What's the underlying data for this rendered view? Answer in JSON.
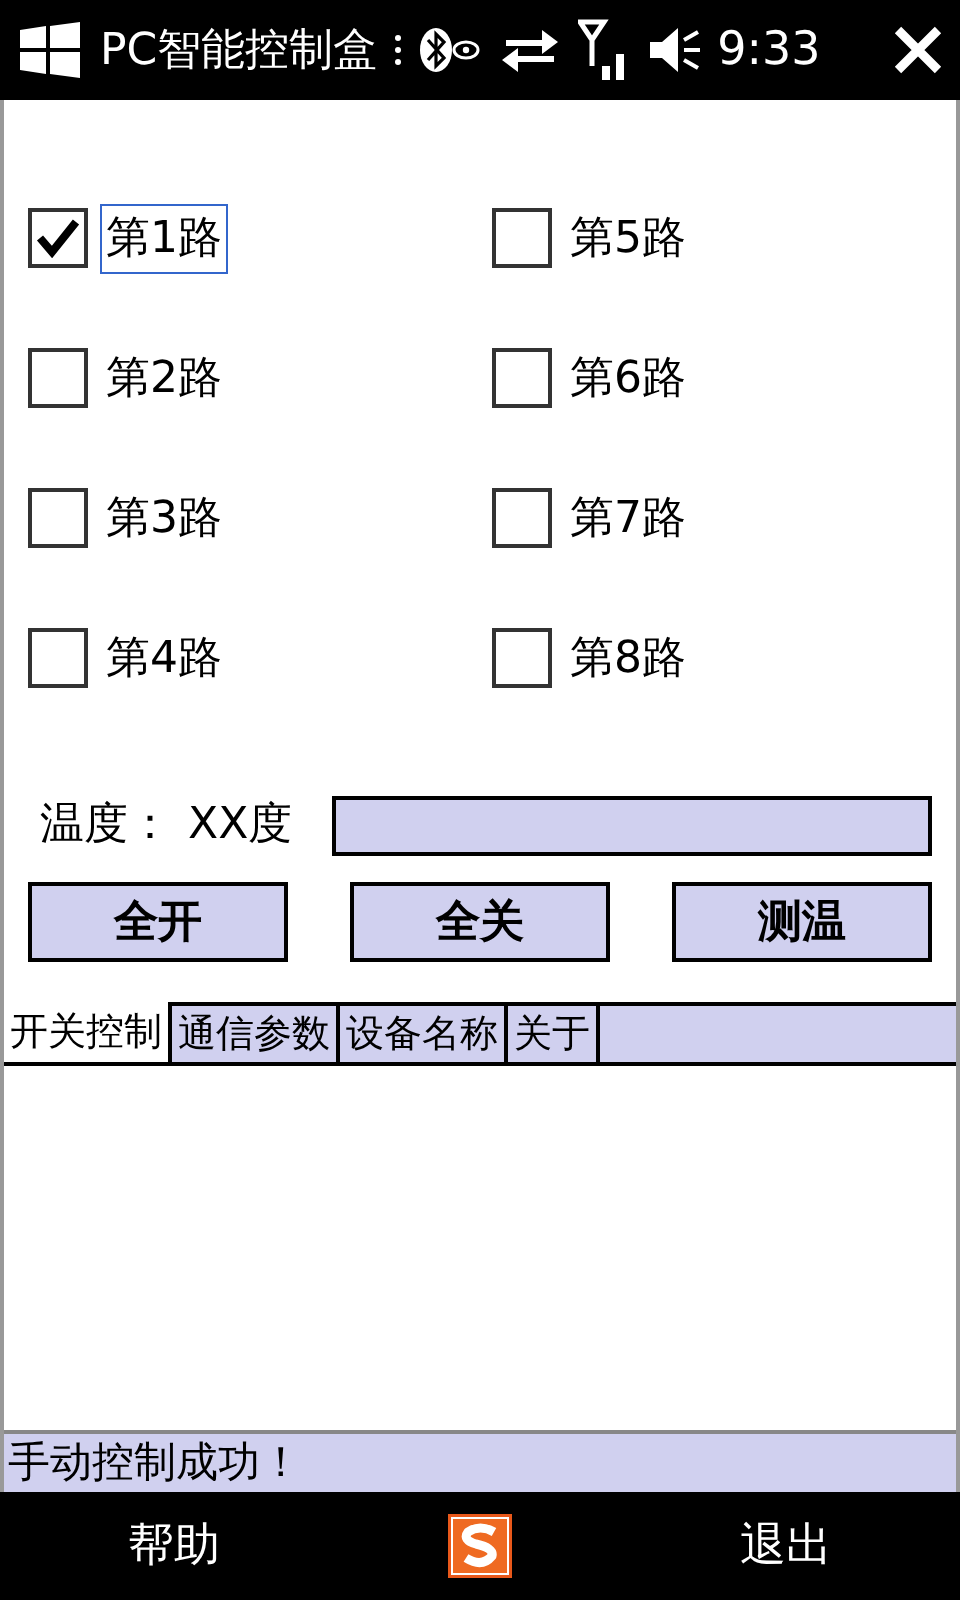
{
  "status_bar": {
    "title": "PC智能控制盒",
    "time": "9:33"
  },
  "channels": [
    {
      "label": "第1路",
      "checked": true,
      "focused": true
    },
    {
      "label": "第5路",
      "checked": false,
      "focused": false
    },
    {
      "label": "第2路",
      "checked": false,
      "focused": false
    },
    {
      "label": "第6路",
      "checked": false,
      "focused": false
    },
    {
      "label": "第3路",
      "checked": false,
      "focused": false
    },
    {
      "label": "第7路",
      "checked": false,
      "focused": false
    },
    {
      "label": "第4路",
      "checked": false,
      "focused": false
    },
    {
      "label": "第8路",
      "checked": false,
      "focused": false
    }
  ],
  "temperature": {
    "label": "温度：",
    "value": "XX度"
  },
  "buttons": [
    "全开",
    "全关",
    "测温"
  ],
  "tabs": [
    {
      "label": "开关控制",
      "selected": true
    },
    {
      "label": "通信参数",
      "selected": false
    },
    {
      "label": "设备名称",
      "selected": false
    },
    {
      "label": "关于",
      "selected": false
    }
  ],
  "message": "手动控制成功！",
  "softkeys": {
    "left": "帮助",
    "right": "退出"
  }
}
